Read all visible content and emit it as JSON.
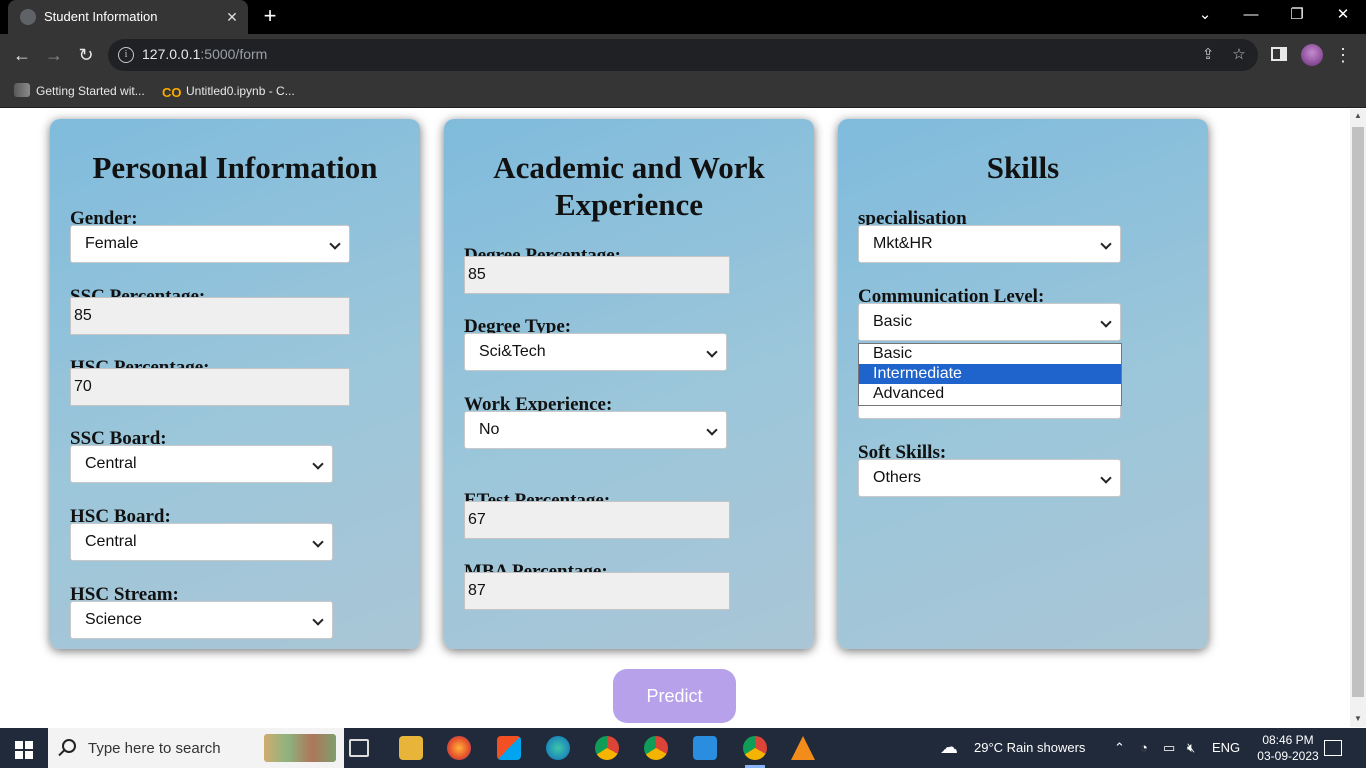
{
  "browser": {
    "tab_title": "Student Information",
    "tab_close": "✕",
    "new_tab": "+",
    "url_host": "127.0.0.1",
    "url_path": ":5000/form",
    "bookmarks": [
      {
        "label": "Getting Started wit..."
      },
      {
        "label": "Untitled0.ipynb - C..."
      }
    ]
  },
  "window_controls": {
    "chevron": "⌄",
    "minimize": "—",
    "restore": "❐",
    "close": "✕"
  },
  "personal": {
    "title": "Personal Information",
    "gender_label": "Gender:",
    "gender_value": "Female",
    "ssc_pct_label": "SSC Percentage:",
    "ssc_pct_value": "85",
    "hsc_pct_label": "HSC Percentage:",
    "hsc_pct_value": "70",
    "ssc_board_label": "SSC Board:",
    "ssc_board_value": "Central",
    "hsc_board_label": "HSC Board:",
    "hsc_board_value": "Central",
    "hsc_stream_label": "HSC Stream:",
    "hsc_stream_value": "Science"
  },
  "academic": {
    "title_line1": "Academic and Work",
    "title_line2": "Experience",
    "degree_pct_label": "Degree Percentage:",
    "degree_pct_value": "85",
    "degree_type_label": "Degree Type:",
    "degree_type_value": "Sci&Tech",
    "work_exp_label": "Work Experience:",
    "work_exp_value": "No",
    "etest_label": "ETest Percentage:",
    "etest_value": "67",
    "mba_label": "MBA Percentage:",
    "mba_value": "87"
  },
  "skills": {
    "title": "Skills",
    "specialisation_label": "specialisation",
    "specialisation_value": "Mkt&HR",
    "communication_label": "Communication Level:",
    "communication_value": "Basic",
    "communication_options": [
      "Basic",
      "Intermediate",
      "Advanced"
    ],
    "highlighted_option": "Intermediate",
    "soft_skills_label": "Soft Skills:",
    "soft_skills_value": "Others"
  },
  "predict_label": "Predict",
  "taskbar": {
    "search_placeholder": "Type here to search",
    "weather": "29°C  Rain showers",
    "language": "ENG",
    "time": "08:46 PM",
    "date": "03-09-2023"
  },
  "colors": {
    "card_gradient_start": "#7fbbdc",
    "card_gradient_end": "#a9c6d6",
    "predict_button": "#b7a1ea",
    "dropdown_highlight": "#1e64cc",
    "taskbar": "#202a3a"
  }
}
